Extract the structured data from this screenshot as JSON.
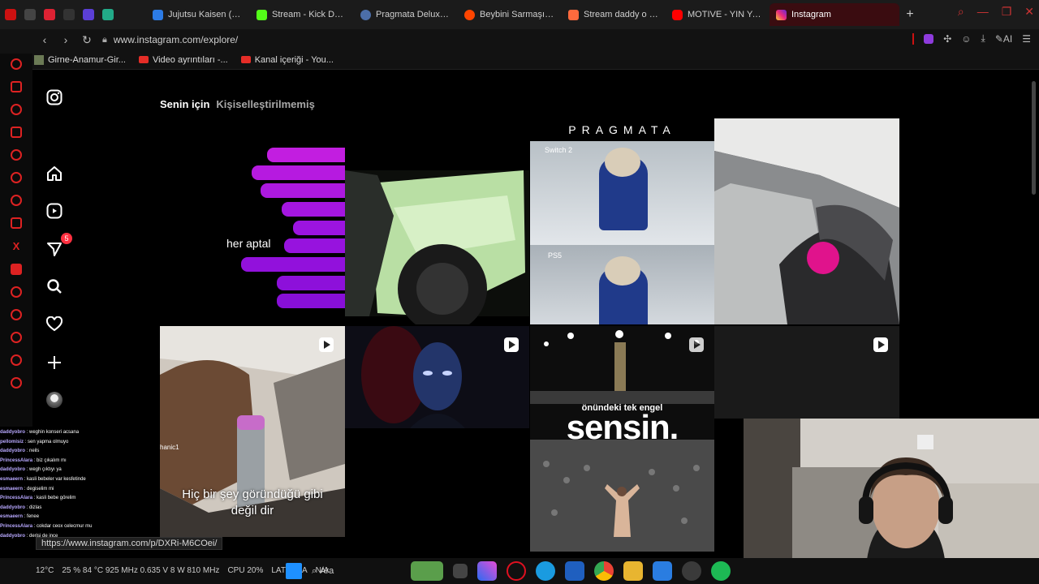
{
  "browser": {
    "tabs": [
      {
        "title": "Jujutsu Kaisen (202",
        "icon": "anime-site-icon",
        "color": "#2c7be5"
      },
      {
        "title": "Stream - Kick Dash",
        "icon": "kick-icon",
        "color": "#53fc18"
      },
      {
        "title": "Pragmata Deluxe Ed",
        "icon": "steam-icon",
        "color": "#1b2838"
      },
      {
        "title": "Beybini Sarmaşık b",
        "icon": "reddit-icon",
        "color": "#ff4500"
      },
      {
        "title": "Stream daddy o arc",
        "icon": "stream-icon",
        "color": "#ff6a3d"
      },
      {
        "title": "MOTIVE - YIN YANG",
        "icon": "youtube-icon",
        "color": "#ff0000"
      },
      {
        "title": "Instagram",
        "icon": "instagram-icon",
        "color": "#e1306c",
        "active": true
      }
    ],
    "url": "www.instagram.com/explore/",
    "ai_label": "AI",
    "bookmarks": [
      {
        "label": "Girne-Anamur-Gir...",
        "icon": "image-icon"
      },
      {
        "label": "Video ayrıntıları -...",
        "icon": "youtube-icon"
      },
      {
        "label": "Kanal içeriği - You...",
        "icon": "youtube-icon"
      }
    ],
    "hover_url": "https://www.instagram.com/p/DXRi-M6COei/"
  },
  "instagram": {
    "nav": [
      {
        "name": "instagram-logo-icon"
      },
      {
        "name": "home-icon"
      },
      {
        "name": "reels-icon"
      },
      {
        "name": "messages-icon",
        "badge": "5"
      },
      {
        "name": "search-icon"
      },
      {
        "name": "notifications-heart-icon"
      },
      {
        "name": "create-plus-icon"
      },
      {
        "name": "profile-avatar"
      }
    ],
    "feed_tabs": {
      "active": "Senin için",
      "other": "Kişiselleştirilmemiş"
    },
    "tiles": {
      "t1_caption": "her aptal",
      "t3_title": "PRAGMATA",
      "t3_top_label": "Switch 2",
      "t3_bottom_label": "PS5",
      "t5_user": "hanic1",
      "t5_caption": "Hiç bir şey göründüğü gibi değil dir",
      "t7_small": "önündeki tek engel",
      "t7_big": "sensin."
    }
  },
  "chat": [
    {
      "user": "daddyobro",
      "msg": "weghin konseri acsana"
    },
    {
      "user": "pellomisiz",
      "msg": "sen yapma olmuyo"
    },
    {
      "user": "daddyobro",
      "msg": "neils"
    },
    {
      "user": "PrincessAlara",
      "msg": "biz çıkalım mı"
    },
    {
      "user": "daddyobro",
      "msg": "wegh çıktıyı ya"
    },
    {
      "user": "esmaeern",
      "msg": "kasli bebeler var kesfetinde"
    },
    {
      "user": "esmaeern",
      "msg": "degiselim mi"
    },
    {
      "user": "PrincessAlara",
      "msg": "kasli bebe görelim"
    },
    {
      "user": "daddyobro",
      "msg": "dizlas"
    },
    {
      "user": "esmaeern",
      "msg": "fenee"
    },
    {
      "user": "PrincessAlara",
      "msg": "cokdar ceox celecmur mu"
    },
    {
      "user": "daddyobro",
      "msg": "derisi de ince"
    }
  ],
  "taskbar": {
    "temp": "12°C",
    "stats": "25 % 84 °C 925 MHz 0.635 V 8 W 810 MHz",
    "cpu": "CPU 20%",
    "lat": "LAT",
    "na1": "N/A",
    "na2": "N/A",
    "search": "Ara"
  }
}
